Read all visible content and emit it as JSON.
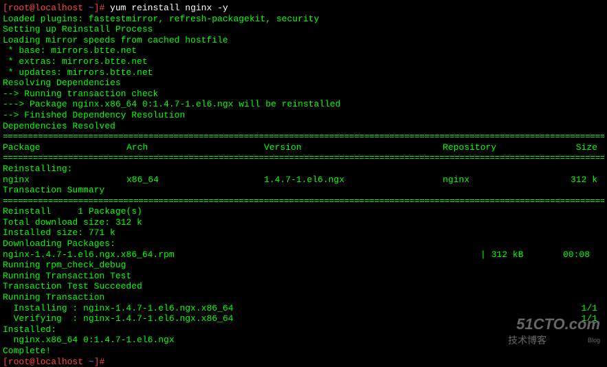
{
  "prompt": {
    "user_host": "[root@localhost ",
    "path": "~",
    "end": "]# ",
    "command": "yum reinstall nginx -y"
  },
  "output": {
    "l1": "Loaded plugins: fastestmirror, refresh-packagekit, security",
    "l2": "Setting up Reinstall Process",
    "l3": "Loading mirror speeds from cached hostfile",
    "l4": " * base: mirrors.btte.net",
    "l5": " * extras: mirrors.btte.net",
    "l6": " * updates: mirrors.btte.net",
    "l7": "Resolving Dependencies",
    "l8": "--> Running transaction check",
    "l9": "---> Package nginx.x86_64 0:1.4.7-1.el6.ngx will be reinstalled",
    "l10": "--> Finished Dependency Resolution",
    "l11": "",
    "l12": "Dependencies Resolved",
    "l13": ""
  },
  "sep": "================================================================================================================================",
  "table": {
    "headers": {
      "package": " Package",
      "arch": "Arch",
      "version": "Version",
      "repo": "Repository",
      "size": "Size"
    },
    "section": "Reinstalling:",
    "row": {
      "package": " nginx",
      "arch": "x86_64",
      "version": "1.4.7-1.el6.ngx",
      "repo": "nginx",
      "size": "312 k"
    }
  },
  "summary": {
    "title": "Transaction Summary",
    "line": "Reinstall     1 Package(s)",
    "blank": ""
  },
  "download": {
    "l1": "Total download size: 312 k",
    "l2": "Installed size: 771 k",
    "l3": "Downloading Packages:",
    "file": "nginx-1.4.7-1.el6.ngx.x86_64.rpm",
    "size": "| 312 kB",
    "time": "00:08",
    "l5": "Running rpm_check_debug",
    "l6": "Running Transaction Test",
    "l7": "Transaction Test Succeeded",
    "l8": "Running Transaction",
    "install": "  Installing : nginx-1.4.7-1.el6.ngx.x86_64",
    "install_count": "1/1",
    "verify": "  Verifying  : nginx-1.4.7-1.el6.ngx.x86_64",
    "verify_count": "1/1",
    "blank": ""
  },
  "installed": {
    "title": "Installed:",
    "pkg": "  nginx.x86_64 0:1.4.7-1.el6.ngx",
    "blank": ""
  },
  "complete": "Complete!",
  "prompt2": {
    "user_host": "[root@localhost ",
    "path": "~",
    "end": "]# "
  },
  "watermark": {
    "line1": "51CTO.com",
    "line2": "技术博客",
    "line3": "Blog"
  }
}
